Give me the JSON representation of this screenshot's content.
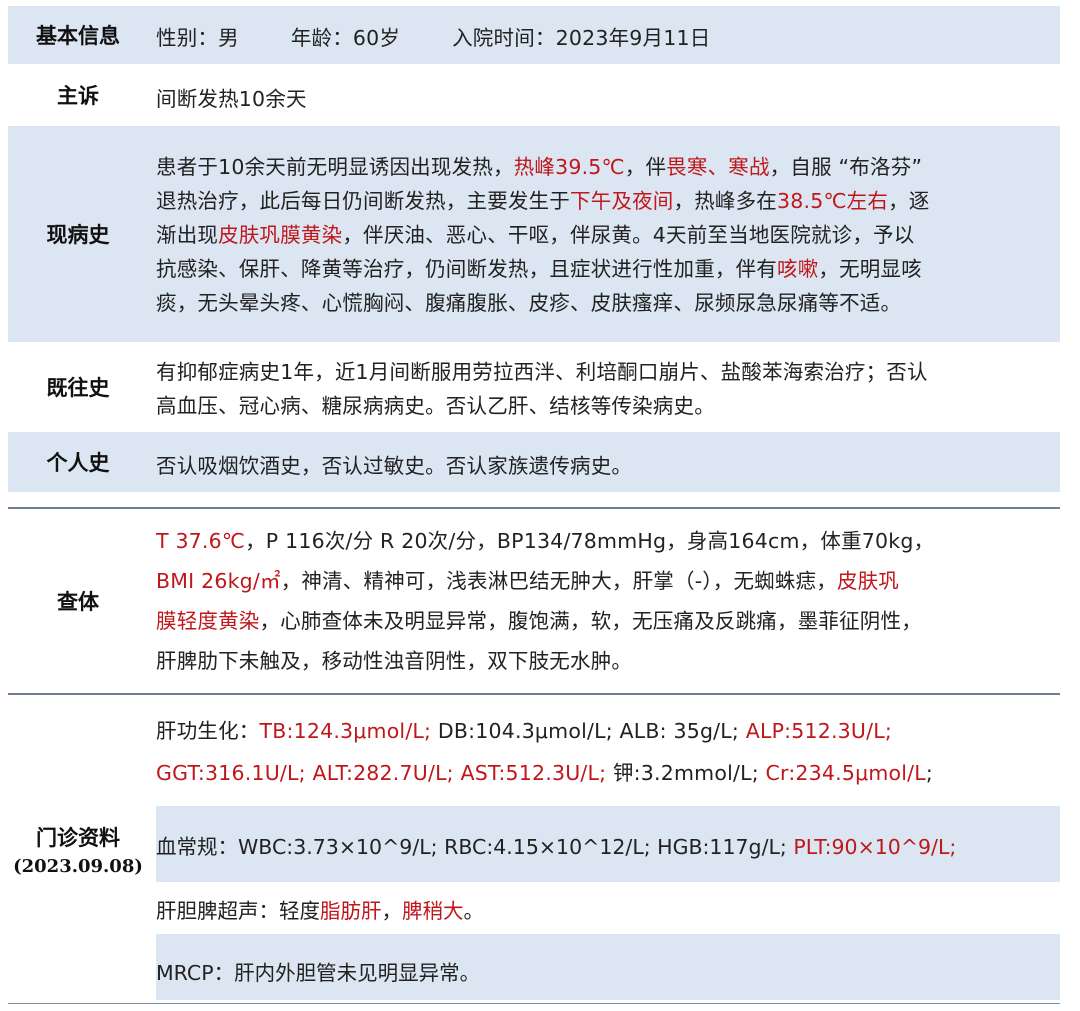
{
  "basic": {
    "label": "基本信息",
    "gender": "性别：男",
    "age": "年龄：60岁",
    "admit": "入院时间：2023年9月11日"
  },
  "chief": {
    "label": "主诉",
    "text": "间断发热10余天"
  },
  "present": {
    "label": "现病史",
    "l1": [
      "患者于10余天前无明显诱因出现发热，",
      "热峰39.5℃",
      "，伴",
      "畏寒、寒战",
      "，自服 “布洛芬”"
    ],
    "l2": [
      "退热治疗，此后每日仍间断发热，主要发生于",
      "下午及夜间",
      "，热峰多在",
      "38.5℃左右",
      "，逐"
    ],
    "l3": [
      "渐出现",
      "皮肤巩膜黄染",
      "，伴厌油、恶心、干呕，伴尿黄。4天前至当地医院就诊，予以"
    ],
    "l4": [
      "抗感染、保肝、降黄等治疗，仍间断发热，且症状进行性加重，伴有",
      "咳嗽",
      "，无明显咳"
    ],
    "l5": "痰，无头晕头疼、心慌胸闷、腹痛腹胀、皮疹、皮肤瘙痒、尿频尿急尿痛等不适。"
  },
  "past": {
    "label": "既往史",
    "l1": "有抑郁症病史1年，近1月间断服用劳拉西泮、利培酮口崩片、盐酸苯海索治疗；否认",
    "l2": "高血压、冠心病、糖尿病病史。否认乙肝、结核等传染病史。"
  },
  "personal": {
    "label": "个人史",
    "text": "否认吸烟饮酒史，否认过敏史。否认家族遗传病史。"
  },
  "exam": {
    "label": "查体",
    "l1": [
      "T 37.6℃",
      "，P 116次/分 R 20次/分，BP134/78mmHg，身高164cm，体重70kg，"
    ],
    "l2": [
      "BMI 26kg/㎡",
      "，神清、精神可，浅表淋巴结无肿大，肝掌（-），无蜘蛛痣，",
      "皮肤巩"
    ],
    "l3": [
      "膜轻度黄染",
      "，心肺查体未及明显异常，腹饱满，软，无压痛及反跳痛，墨菲征阴性，"
    ],
    "l4": "肝脾肋下未触及，移动性浊音阴性，双下肢无水肿。"
  },
  "outpatient": {
    "label": "门诊资料",
    "date": "(2023.09.08)",
    "liver_prefix": "肝功生化：",
    "tb": "TB:124.3μmol/L;",
    "db_alb": " DB:104.3μmol/L; ALB: 35g/L;",
    "alp": "ALP:512.3U/L;",
    "ggt": "GGT:316.1U/L;",
    "alt": "ALT:282.7U/L;",
    "ast": "AST:512.3U/L;",
    "k": " 钾:3.2mmol/L;",
    "cr": "Cr:234.5μmol/L",
    "cr_end": ";",
    "blood_prefix": "血常规：",
    "blood_text": "WBC:3.73×10^9/L; RBC:4.15×10^12/L; HGB:117g/L;",
    "plt": "PLT:90×10^9/L;",
    "us_prefix": "肝胆脾超声：轻度",
    "us_fat": "脂肪肝",
    "us_sep": "，",
    "us_spleen": "脾稍大",
    "us_end": "。",
    "mrcp": "MRCP：肝内外胆管未见明显异常。"
  },
  "colors": {
    "highlight": "#c0171b",
    "band": "#dbe6f2",
    "rule": "#7f8ea3"
  }
}
